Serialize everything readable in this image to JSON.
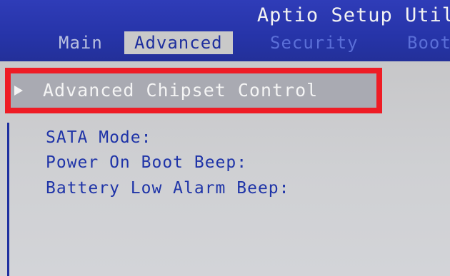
{
  "header": {
    "title": "Aptio Setup Util",
    "tabs": [
      {
        "label": "Main"
      },
      {
        "label": "Advanced"
      },
      {
        "label": "Security"
      },
      {
        "label": "Boot"
      }
    ]
  },
  "main": {
    "submenu": {
      "label": "Advanced Chipset Control",
      "icon": "triangle-right-icon"
    },
    "settings": [
      {
        "label": "SATA Mode:"
      },
      {
        "label": "Power On Boot Beep:"
      },
      {
        "label": "Battery Low Alarm Beep:"
      }
    ]
  },
  "colors": {
    "header_bg": "#2a36a6",
    "panel_bg": "#cfd0d3",
    "selected_tab_bg": "#c9c9c9",
    "item_text": "#1f34a8",
    "annotation_border": "#ee1c25"
  }
}
